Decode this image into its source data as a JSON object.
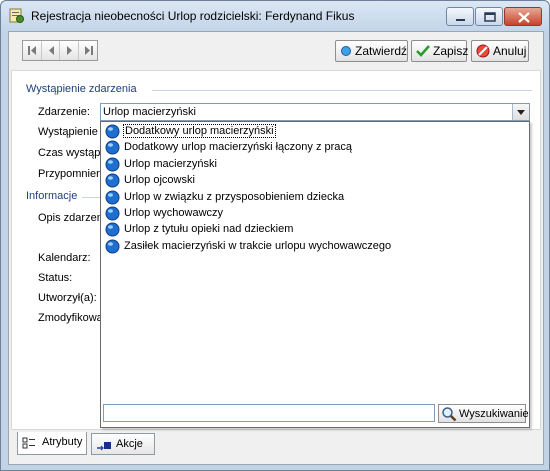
{
  "window": {
    "title": "Rejestracja nieobecności Urlop rodzicielski:  Ferdynand Fikus"
  },
  "toolbar": {
    "confirm_label": "Zatwierdź",
    "save_label": "Zapisz",
    "cancel_label": "Anuluj"
  },
  "section_event": {
    "title": "Wystąpienie zdarzenia",
    "labels": {
      "event": "Zdarzenie:",
      "occurrence": "Wystąpienie",
      "duration": "Czas wystąp",
      "reminder": "Przypomnien"
    }
  },
  "event_combo": {
    "value": "Urlop macierzyński"
  },
  "section_info": {
    "title": "Informacje",
    "labels": {
      "description": "Opis zdarzen",
      "calendar": "Kalendarz:",
      "status": "Status:",
      "created": "Utworzył(a):",
      "modified": "Zmodyfikowa"
    }
  },
  "dropdown": {
    "items": [
      "Dodatkowy urlop macierzyński",
      "Dodatkowy urlop macierzyński łączony z pracą",
      "Urlop macierzyński",
      "Urlop ojcowski",
      "Urlop w związku z przysposobieniem dziecka",
      "Urlop wychowawczy",
      "Urlop z tytułu opieki nad dzieckiem",
      "Zasiłek macierzyński w trakcie urlopu wychowawczego"
    ],
    "search_value": "",
    "search_button": "Wyszukiwanie"
  },
  "tabs": [
    {
      "label": "Atrybuty"
    },
    {
      "label": "Akcje"
    }
  ],
  "colors": {
    "accent": "#1f3f79",
    "item_icon": "#1e6fd0",
    "save_icon": "#2a9a2a",
    "cancel_icon": "#cc2222"
  }
}
